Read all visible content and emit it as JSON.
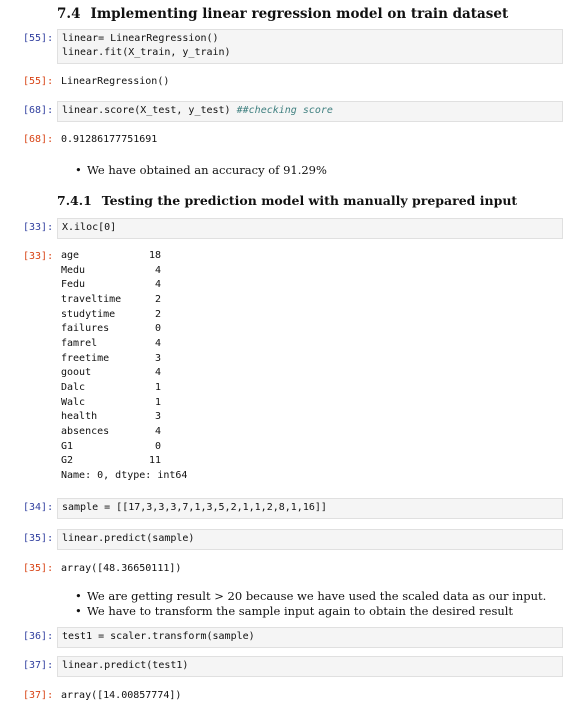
{
  "section_74": {
    "number": "7.4",
    "title": "Implementing linear regression model on train dataset"
  },
  "cells": {
    "c1": {
      "prompt": "[55]:",
      "lines": [
        "linear= LinearRegression()",
        "linear.fit(X_train, y_train)"
      ]
    },
    "o1": {
      "prompt": "[55]:",
      "text": "LinearRegression()"
    },
    "c2": {
      "prompt": "[68]:",
      "code": "linear.score(X_test, y_test) ",
      "comment": "##checking score"
    },
    "o2": {
      "prompt": "[68]:",
      "text": "0.91286177751691"
    },
    "c3": {
      "prompt": "[33]:",
      "code": "X.iloc[0]"
    },
    "o3": {
      "prompt": "[33]:"
    },
    "c4": {
      "prompt": "[34]:",
      "code": "sample = [[17,3,3,3,7,1,3,5,2,1,1,2,8,1,16]]"
    },
    "c5": {
      "prompt": "[35]:",
      "code": "linear.predict(sample)"
    },
    "o5": {
      "prompt": "[35]:",
      "text": "array([48.36650111])"
    },
    "c6": {
      "prompt": "[36]:",
      "code": "test1 = scaler.transform(sample)"
    },
    "c7": {
      "prompt": "[37]:",
      "code": "linear.predict(test1)"
    },
    "o7": {
      "prompt": "[37]:",
      "text": "array([14.00857774])"
    }
  },
  "bullet1": "We have obtained an accuracy of 91.29%",
  "section_741": {
    "number": "7.4.1",
    "title": "Testing the prediction model with manually prepared input"
  },
  "series": {
    "rows": [
      {
        "key": "age",
        "value": "18"
      },
      {
        "key": "Medu",
        "value": "4"
      },
      {
        "key": "Fedu",
        "value": "4"
      },
      {
        "key": "traveltime",
        "value": "2"
      },
      {
        "key": "studytime",
        "value": "2"
      },
      {
        "key": "failures",
        "value": "0"
      },
      {
        "key": "famrel",
        "value": "4"
      },
      {
        "key": "freetime",
        "value": "3"
      },
      {
        "key": "goout",
        "value": "4"
      },
      {
        "key": "Dalc",
        "value": "1"
      },
      {
        "key": "Walc",
        "value": "1"
      },
      {
        "key": "health",
        "value": "3"
      },
      {
        "key": "absences",
        "value": "4"
      },
      {
        "key": "G1",
        "value": "0"
      },
      {
        "key": "G2",
        "value": "11"
      }
    ],
    "footer": "Name: 0, dtype: int64"
  },
  "bullets2": [
    "We are getting result > 20 because we have used the scaled data as our input.",
    "We have to transform the sample input again to obtain the desired result"
  ]
}
